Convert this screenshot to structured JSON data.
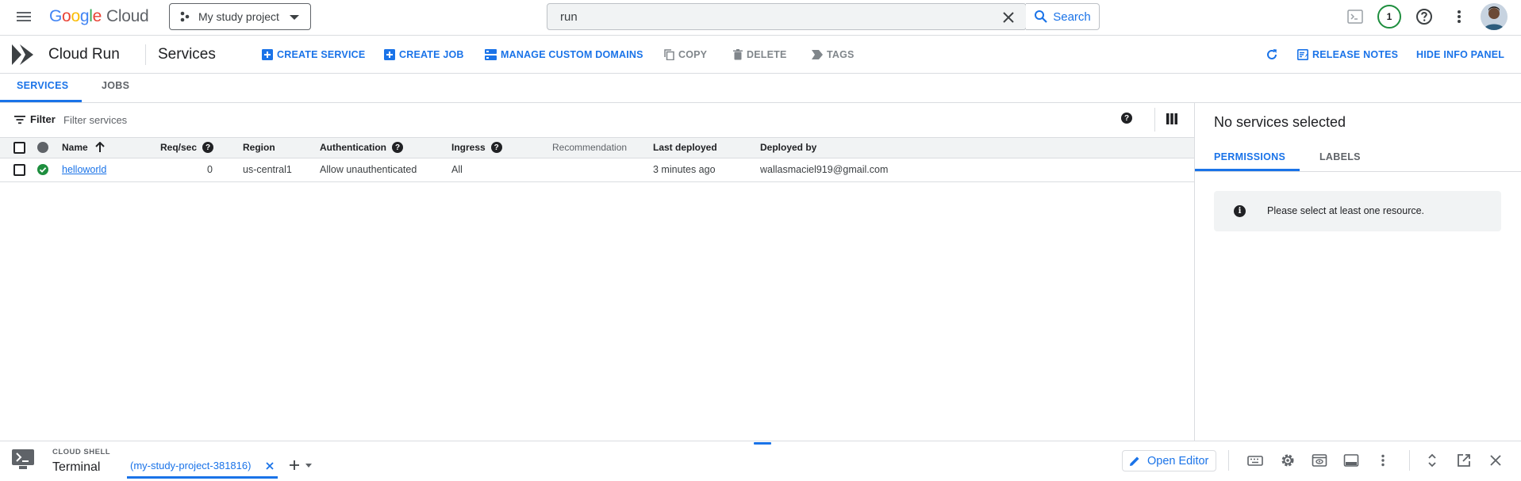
{
  "topbar": {
    "logo_google": [
      "G",
      "o",
      "o",
      "g",
      "l",
      "e"
    ],
    "logo_cloud": "Cloud",
    "project": "My study project",
    "search_value": "run",
    "search_button": "Search",
    "notifications_count": "1"
  },
  "product": {
    "name": "Cloud Run",
    "page_title": "Services"
  },
  "actions": {
    "create_service": "CREATE SERVICE",
    "create_job": "CREATE JOB",
    "manage_domains": "MANAGE CUSTOM DOMAINS",
    "copy": "COPY",
    "delete": "DELETE",
    "tags": "TAGS",
    "release_notes": "RELEASE NOTES",
    "hide_info_panel": "HIDE INFO PANEL"
  },
  "tabs": [
    {
      "label": "SERVICES",
      "active": true
    },
    {
      "label": "JOBS",
      "active": false
    }
  ],
  "filter": {
    "label": "Filter",
    "placeholder": "Filter services"
  },
  "table": {
    "headers": {
      "name": "Name",
      "req_sec": "Req/sec",
      "region": "Region",
      "authentication": "Authentication",
      "ingress": "Ingress",
      "recommendation": "Recommendation",
      "last_deployed": "Last deployed",
      "deployed_by": "Deployed by"
    },
    "rows": [
      {
        "name": "helloworld",
        "req_sec": "0",
        "region": "us-central1",
        "authentication": "Allow unauthenticated",
        "ingress": "All",
        "recommendation": "",
        "last_deployed": "3 minutes ago",
        "deployed_by": "wallasmaciel919@gmail.com",
        "status": "ok"
      }
    ]
  },
  "info_panel": {
    "title": "No services selected",
    "tabs": [
      "PERMISSIONS",
      "LABELS"
    ],
    "message": "Please select at least one resource."
  },
  "cloud_shell": {
    "kicker": "CLOUD SHELL",
    "title": "Terminal",
    "tab": "(my-study-project-381816)",
    "open_editor": "Open Editor"
  },
  "colors": {
    "accent": "#1a73e8",
    "status_ok": "#1e8e3e",
    "header_bg": "#f1f3f4"
  }
}
